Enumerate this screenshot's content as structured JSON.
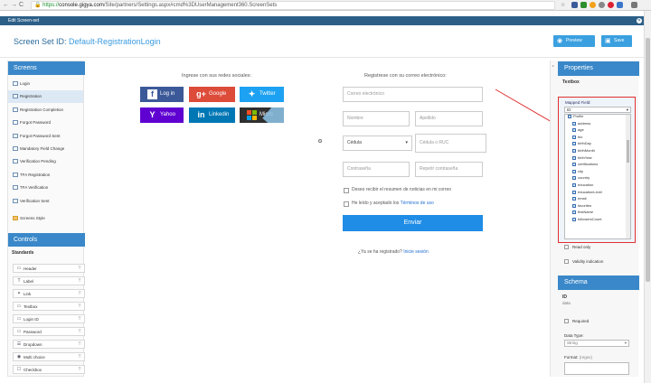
{
  "browser": {
    "url_scheme": "https://",
    "url_host": "console.gigya.com",
    "url_path": "/Site/partners/Settings.aspx#cmd%3DUserManagement360.ScreenSets"
  },
  "app": {
    "dialog_title": "Edit Screen-set",
    "screen_set_label": "Screen Set ID:",
    "screen_set_id": "Default-RegistrationLogin",
    "preview_label": "Preview",
    "save_label": "Save"
  },
  "screens": {
    "heading": "Screens",
    "items": [
      {
        "label": "Login"
      },
      {
        "label": "Registration"
      },
      {
        "label": "Registration Completion"
      },
      {
        "label": "Forgot Password"
      },
      {
        "label": "Forgot Password Sent"
      },
      {
        "label": "Mandatory Field Change"
      },
      {
        "label": "Verification Pending"
      },
      {
        "label": "TFA Registration"
      },
      {
        "label": "TFA Verification"
      },
      {
        "label": "Verification Sent"
      }
    ],
    "style_label": "Screens Style"
  },
  "controls": {
    "heading": "Controls",
    "subheading": "Standards",
    "items": [
      {
        "label": "Header"
      },
      {
        "label": "Label"
      },
      {
        "label": "Link"
      },
      {
        "label": "Textbox"
      },
      {
        "label": "Login ID"
      },
      {
        "label": "Password"
      },
      {
        "label": "Dropdown"
      },
      {
        "label": "Multi choice"
      },
      {
        "label": "Checkbox"
      }
    ]
  },
  "form": {
    "social_heading": "Ingrese con sus redes sociales:",
    "email_heading": "Registrese con su correo electrónico:",
    "social_buttons": [
      {
        "label": "Log in",
        "color": "#3b5998"
      },
      {
        "label": "Google",
        "color": "#dd4b39"
      },
      {
        "label": "Twitter",
        "color": "#1da1f2"
      },
      {
        "label": "Yahoo",
        "color": "#5f01d1"
      },
      {
        "label": "Linkedin",
        "color": "#0077b5"
      },
      {
        "label": "Micro",
        "color": "#2f2f2f"
      }
    ],
    "placeholders": {
      "email": "Correo electrónico",
      "first_name": "Nombre",
      "last_name": "Apellido",
      "doc_type": "Cédula",
      "doc_number": "Cédula o RUC",
      "password": "Contraseña",
      "password_repeat": "Repetir contraseña"
    },
    "newsletter_label": "Deseo recibir el resumen de noticias en mi correo",
    "terms_prefix": "He leído y aceptado los ",
    "terms_link": "Términos de uso",
    "submit_label": "Enviar",
    "already_registered": "¿Ya se ha registrado?",
    "login_link": "Inicie sesión"
  },
  "properties": {
    "heading": "Properties",
    "control_type": "Textbox",
    "mapped_field_label": "Mapped Field:",
    "mapped_field_value": "ID",
    "tree_items": [
      {
        "label": "Profile"
      },
      {
        "label": "address"
      },
      {
        "label": "age"
      },
      {
        "label": "bio"
      },
      {
        "label": "birthDay"
      },
      {
        "label": "birthMonth"
      },
      {
        "label": "birthYear"
      },
      {
        "label": "certifications"
      },
      {
        "label": "city"
      },
      {
        "label": "country"
      },
      {
        "label": "education"
      },
      {
        "label": "educationLevel"
      },
      {
        "label": "email"
      },
      {
        "label": "favorites"
      },
      {
        "label": "firstName"
      },
      {
        "label": "followersCount"
      }
    ],
    "read_only_label": "Read only",
    "validity_label": "Validity indication"
  },
  "schema": {
    "heading": "Schema",
    "field_id": "ID",
    "field_scope": "data",
    "required_label": "Required",
    "data_type_label": "Data Type:",
    "data_type_value": "String",
    "format_label": "Format:",
    "format_hint": "(regex)"
  },
  "colors": {
    "header_blue": "#2b5f88",
    "panel_blue": "#3a88c9",
    "button_blue": "#3aa0e0",
    "submit_blue": "#1f8ce6",
    "annotation_red": "#e03030"
  }
}
